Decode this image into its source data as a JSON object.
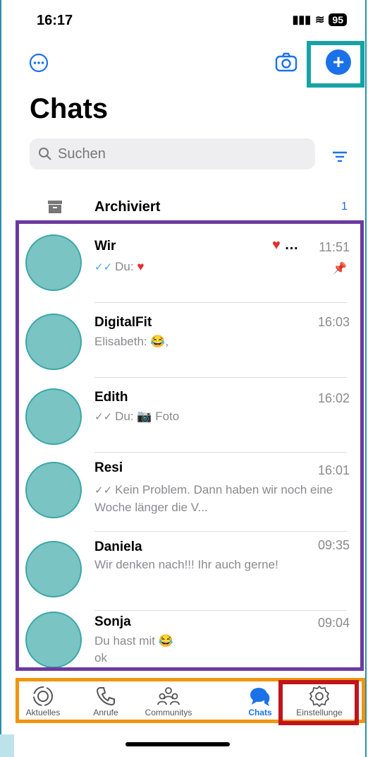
{
  "status": {
    "time": "16:17",
    "battery": "95"
  },
  "header": {
    "title": "Chats"
  },
  "search": {
    "placeholder": "Suchen"
  },
  "archived": {
    "label": "Archiviert",
    "count": "1"
  },
  "chats": [
    {
      "name": "Wir",
      "time": "11:51",
      "preview": "Du: ",
      "pinned": true
    },
    {
      "name": "DigitalFit",
      "time": "16:03",
      "preview": "Elisabeth: 😂,"
    },
    {
      "name": "Edith",
      "time": "16:02",
      "preview": "Du: 📷 Foto"
    },
    {
      "name": "Resi",
      "time": "16:01",
      "preview": "Kein Problem. Dann haben wir noch eine Woche länger die V..."
    },
    {
      "name": "Daniela",
      "time": "09:35",
      "preview": "Wir denken nach!!! Ihr auch gerne!"
    },
    {
      "name": "Sonja",
      "time": "09:04",
      "preview": "Du hast mit 😂",
      "preview2": "ok"
    }
  ],
  "tabs": [
    {
      "label": "Aktuelles",
      "icon": "updates-icon"
    },
    {
      "label": "Anrufe",
      "icon": "phone-icon"
    },
    {
      "label": "Communitys",
      "icon": "communities-icon"
    },
    {
      "label": "Chats",
      "icon": "chats-icon",
      "active": true
    },
    {
      "label": "Einstellunge",
      "icon": "settings-icon"
    }
  ],
  "colors": {
    "accent": "#1b72e8",
    "highlight_teal": "#17a3a5",
    "highlight_purple": "#6b3aa0",
    "highlight_orange": "#f0950e",
    "highlight_red": "#c0141c",
    "avatar": "#7bc4c4"
  }
}
